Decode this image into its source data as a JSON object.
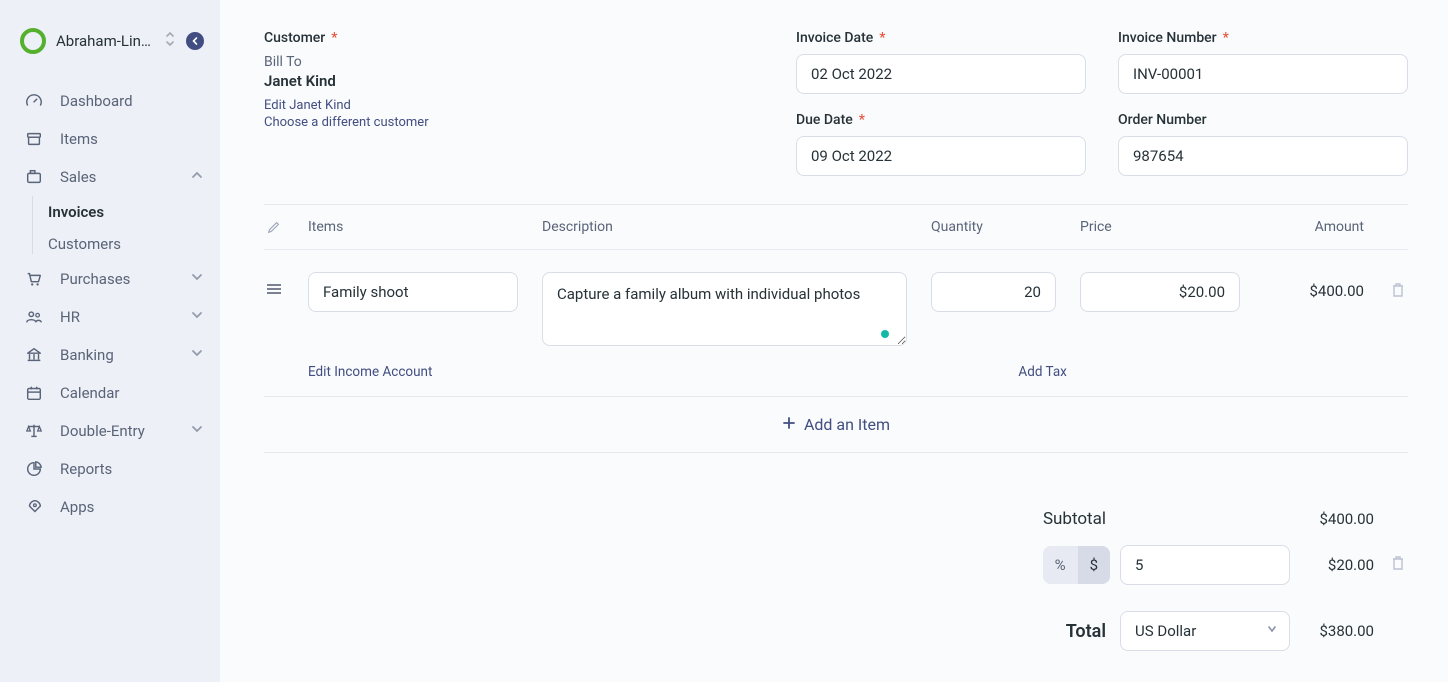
{
  "sidebar": {
    "company": "Abraham-Lin…",
    "items": [
      {
        "icon": "dashboard",
        "label": "Dashboard"
      },
      {
        "icon": "items",
        "label": "Items"
      },
      {
        "icon": "sales",
        "label": "Sales",
        "expanded": true,
        "children": [
          {
            "label": "Invoices",
            "active": true
          },
          {
            "label": "Customers"
          }
        ]
      },
      {
        "icon": "purchases",
        "label": "Purchases",
        "expandable": true
      },
      {
        "icon": "hr",
        "label": "HR",
        "expandable": true
      },
      {
        "icon": "banking",
        "label": "Banking",
        "expandable": true
      },
      {
        "icon": "calendar",
        "label": "Calendar"
      },
      {
        "icon": "double-entry",
        "label": "Double-Entry",
        "expandable": true
      },
      {
        "icon": "reports",
        "label": "Reports"
      },
      {
        "icon": "apps",
        "label": "Apps"
      }
    ]
  },
  "form": {
    "customer_label": "Customer",
    "bill_to_label": "Bill To",
    "bill_to_name": "Janet Kind",
    "edit_customer_link": "Edit Janet Kind",
    "choose_customer_link": "Choose a different customer",
    "invoice_date": {
      "label": "Invoice Date",
      "value": "02 Oct 2022"
    },
    "invoice_number": {
      "label": "Invoice Number",
      "value": "INV-00001"
    },
    "due_date": {
      "label": "Due Date",
      "value": "09 Oct 2022"
    },
    "order_number": {
      "label": "Order Number",
      "value": "987654"
    }
  },
  "items_table": {
    "headers": {
      "items": "Items",
      "description": "Description",
      "quantity": "Quantity",
      "price": "Price",
      "amount": "Amount"
    },
    "row": {
      "name": "Family shoot",
      "description": "Capture a family album with individual photos",
      "qty": "20",
      "price": "$20.00",
      "amount": "$400.00"
    },
    "edit_income_link": "Edit Income Account",
    "add_tax_link": "Add Tax",
    "add_item_label": "Add an Item"
  },
  "totals": {
    "subtotal_label": "Subtotal",
    "subtotal_value": "$400.00",
    "discount": {
      "percent_symbol": "%",
      "dollar_symbol": "$",
      "active": "percent",
      "value": "5",
      "amount": "$20.00"
    },
    "total_label": "Total",
    "currency": "US Dollar",
    "total_value": "$380.00"
  }
}
